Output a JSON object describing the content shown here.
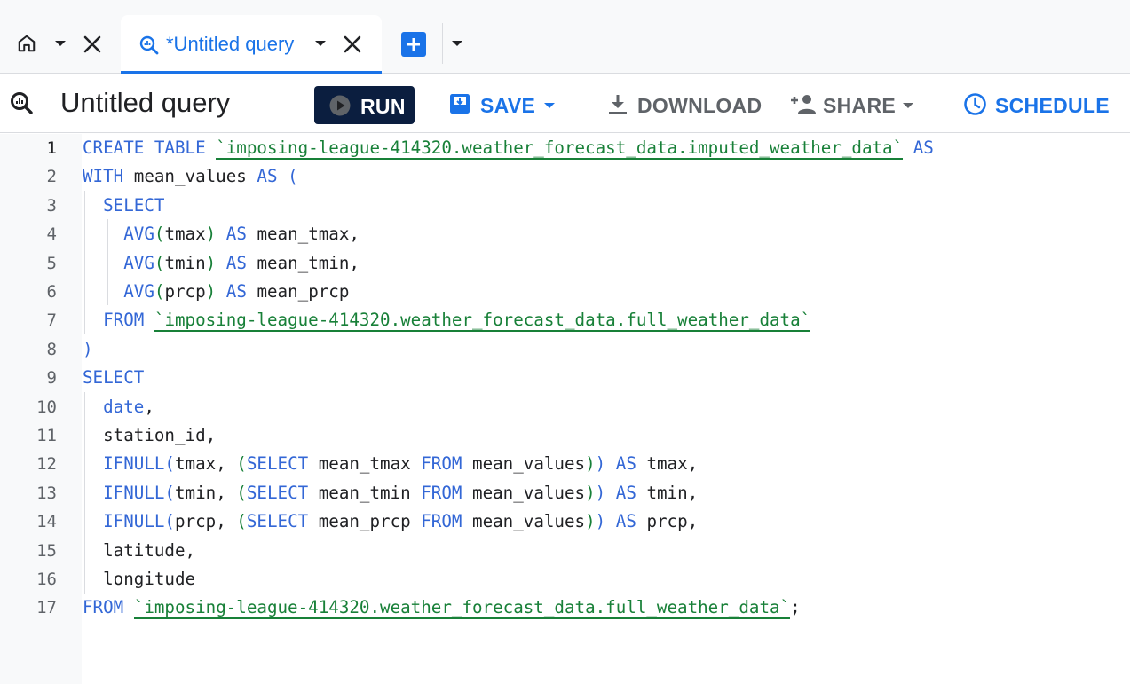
{
  "tabs": {
    "home_icon": "home-icon",
    "active_tab": {
      "label": "*Untitled query",
      "icon": "query-icon"
    },
    "add_tab_icon": "plus-icon"
  },
  "toolbar": {
    "title": "Untitled query",
    "run_label": "RUN",
    "save_label": "SAVE",
    "download_label": "DOWNLOAD",
    "share_label": "SHARE",
    "schedule_label": "SCHEDULE"
  },
  "editor": {
    "active_line": 1,
    "line_numbers": [
      "1",
      "2",
      "3",
      "4",
      "5",
      "6",
      "7",
      "8",
      "9",
      "10",
      "11",
      "12",
      "13",
      "14",
      "15",
      "16",
      "17"
    ],
    "lines": [
      [
        {
          "t": "CREATE TABLE",
          "c": "kw"
        },
        {
          "t": " "
        },
        {
          "t": "`imposing-league-414320.weather_forecast_data.imputed_weather_data`",
          "c": "str"
        },
        {
          "t": " "
        },
        {
          "t": "AS",
          "c": "kw"
        }
      ],
      [
        {
          "t": "WITH",
          "c": "kw"
        },
        {
          "t": " mean_values "
        },
        {
          "t": "AS",
          "c": "kw"
        },
        {
          "t": " "
        },
        {
          "t": "(",
          "c": "p1"
        }
      ],
      [
        {
          "t": "  "
        },
        {
          "t": "SELECT",
          "c": "kw"
        }
      ],
      [
        {
          "t": "    "
        },
        {
          "t": "AVG",
          "c": "kw"
        },
        {
          "t": "(",
          "c": "p2"
        },
        {
          "t": "tmax"
        },
        {
          "t": ")",
          "c": "p2"
        },
        {
          "t": " "
        },
        {
          "t": "AS",
          "c": "kw"
        },
        {
          "t": " mean_tmax,"
        }
      ],
      [
        {
          "t": "    "
        },
        {
          "t": "AVG",
          "c": "kw"
        },
        {
          "t": "(",
          "c": "p2"
        },
        {
          "t": "tmin"
        },
        {
          "t": ")",
          "c": "p2"
        },
        {
          "t": " "
        },
        {
          "t": "AS",
          "c": "kw"
        },
        {
          "t": " mean_tmin,"
        }
      ],
      [
        {
          "t": "    "
        },
        {
          "t": "AVG",
          "c": "kw"
        },
        {
          "t": "(",
          "c": "p2"
        },
        {
          "t": "prcp"
        },
        {
          "t": ")",
          "c": "p2"
        },
        {
          "t": " "
        },
        {
          "t": "AS",
          "c": "kw"
        },
        {
          "t": " mean_prcp"
        }
      ],
      [
        {
          "t": "  "
        },
        {
          "t": "FROM",
          "c": "kw"
        },
        {
          "t": " "
        },
        {
          "t": "`imposing-league-414320.weather_forecast_data.full_weather_data`",
          "c": "str"
        }
      ],
      [
        {
          "t": ")",
          "c": "p1"
        }
      ],
      [
        {
          "t": "SELECT",
          "c": "kw"
        }
      ],
      [
        {
          "t": "  "
        },
        {
          "t": "date",
          "c": "kw"
        },
        {
          "t": ","
        }
      ],
      [
        {
          "t": "  station_id,"
        }
      ],
      [
        {
          "t": "  "
        },
        {
          "t": "IFNULL",
          "c": "kw"
        },
        {
          "t": "(",
          "c": "p1"
        },
        {
          "t": "tmax, "
        },
        {
          "t": "(",
          "c": "p2"
        },
        {
          "t": "SELECT",
          "c": "kw"
        },
        {
          "t": " mean_tmax "
        },
        {
          "t": "FROM",
          "c": "kw"
        },
        {
          "t": " mean_values"
        },
        {
          "t": ")",
          "c": "p2"
        },
        {
          "t": ")",
          "c": "p1"
        },
        {
          "t": " "
        },
        {
          "t": "AS",
          "c": "kw"
        },
        {
          "t": " tmax,"
        }
      ],
      [
        {
          "t": "  "
        },
        {
          "t": "IFNULL",
          "c": "kw"
        },
        {
          "t": "(",
          "c": "p1"
        },
        {
          "t": "tmin, "
        },
        {
          "t": "(",
          "c": "p2"
        },
        {
          "t": "SELECT",
          "c": "kw"
        },
        {
          "t": " mean_tmin "
        },
        {
          "t": "FROM",
          "c": "kw"
        },
        {
          "t": " mean_values"
        },
        {
          "t": ")",
          "c": "p2"
        },
        {
          "t": ")",
          "c": "p1"
        },
        {
          "t": " "
        },
        {
          "t": "AS",
          "c": "kw"
        },
        {
          "t": " tmin,"
        }
      ],
      [
        {
          "t": "  "
        },
        {
          "t": "IFNULL",
          "c": "kw"
        },
        {
          "t": "(",
          "c": "p1"
        },
        {
          "t": "prcp, "
        },
        {
          "t": "(",
          "c": "p2"
        },
        {
          "t": "SELECT",
          "c": "kw"
        },
        {
          "t": " mean_prcp "
        },
        {
          "t": "FROM",
          "c": "kw"
        },
        {
          "t": " mean_values"
        },
        {
          "t": ")",
          "c": "p2"
        },
        {
          "t": ")",
          "c": "p1"
        },
        {
          "t": " "
        },
        {
          "t": "AS",
          "c": "kw"
        },
        {
          "t": " prcp,"
        }
      ],
      [
        {
          "t": "  latitude,"
        }
      ],
      [
        {
          "t": "  longitude"
        }
      ],
      [
        {
          "t": "FROM",
          "c": "kw"
        },
        {
          "t": " "
        },
        {
          "t": "`imposing-league-414320.weather_forecast_data.full_weather_data`",
          "c": "str"
        },
        {
          "t": ";"
        }
      ]
    ]
  },
  "colors": {
    "accent": "#1a73e8",
    "run_button": "#0b1e3f",
    "keyword": "#3367d6",
    "string": "#188038"
  }
}
